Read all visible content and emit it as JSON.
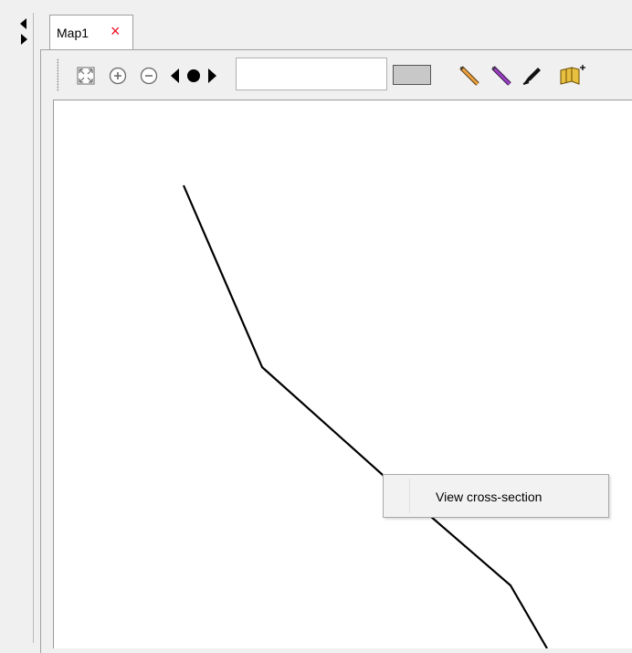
{
  "window": {
    "tab_label": "Map1",
    "tab_close_glyph": "×"
  },
  "toolbar": {
    "icons": [
      "zoom-extent-icon",
      "zoom-in-icon",
      "zoom-out-icon",
      "pan-icon",
      "draw-line-orange-icon",
      "draw-line-purple-icon",
      "edit-pen-icon",
      "add-section-icon"
    ],
    "coordinate_value": "",
    "swatch_color": "#c8c8c8"
  },
  "context_menu": {
    "items": [
      {
        "label": "View cross-section"
      }
    ]
  },
  "colors": {
    "close": "#e81123",
    "line": "#000000",
    "panel_bg": "#f0f0f0",
    "map_bg": "#ffffff"
  }
}
